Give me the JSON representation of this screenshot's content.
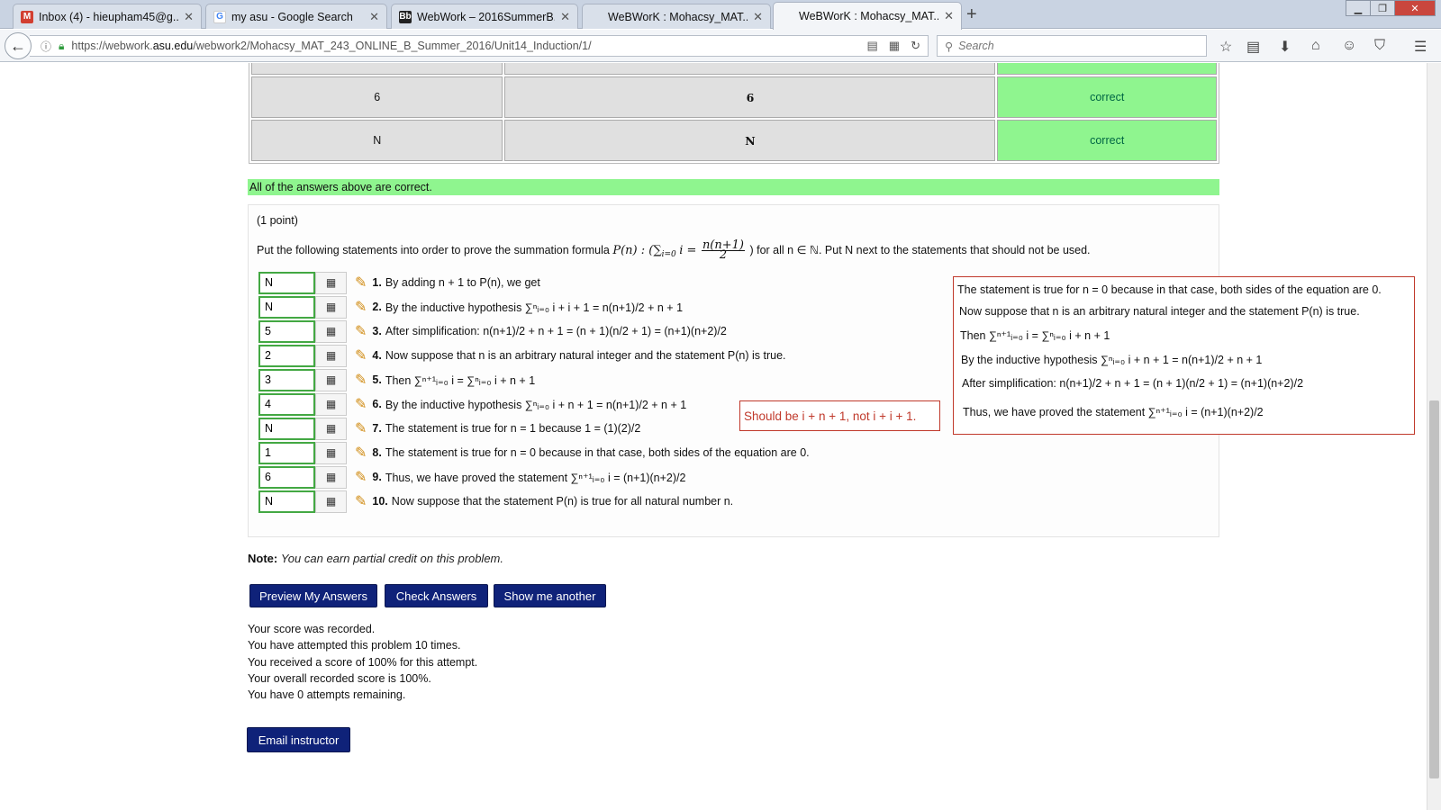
{
  "browser": {
    "tabs": [
      {
        "title": "Inbox (4) - hieupham45@g...",
        "favicon": "gmail-icon",
        "active": false
      },
      {
        "title": "my asu - Google Search",
        "favicon": "google-icon",
        "active": false
      },
      {
        "title": "WebWork – 2016SummerB...",
        "favicon": "blackboard-icon",
        "active": false
      },
      {
        "title": "WeBWorK : Mohacsy_MAT...",
        "favicon": "none",
        "active": false
      },
      {
        "title": "WeBWorK : Mohacsy_MAT...",
        "favicon": "none",
        "active": true
      }
    ],
    "url_prefix": "https://webwork.",
    "url_domain": "asu.edu",
    "url_path": "/webwork2/Mohacsy_MAT_243_ONLINE_B_Summer_2016/Unit14_Induction/1/",
    "search_placeholder": "Search"
  },
  "answers_table": {
    "rows": [
      {
        "entered": "6",
        "preview": "6",
        "result": "correct"
      },
      {
        "entered": "N",
        "preview": "N",
        "result": "correct"
      }
    ]
  },
  "all_correct_message": "All of the answers above are correct.",
  "problem": {
    "points": "(1 point)",
    "instructions_prefix": "Put the following statements into order to prove the summation formula",
    "instructions_formula_pre": "P(n) : (∑",
    "instructions_formula_i": "i =",
    "instructions_frac_top": "n(n+1)",
    "instructions_frac_bot": "2",
    "instructions_suffix": ") for all n ∈ ℕ. Put N next to the statements that should not be used.",
    "statements": [
      {
        "answer": "N",
        "num": "1.",
        "text": "By adding n + 1 to P(n), we get"
      },
      {
        "answer": "N",
        "num": "2.",
        "text": "By the inductive hypothesis ∑ⁿᵢ₌₀ i + i + 1 = n(n+1)/2 + n + 1"
      },
      {
        "answer": "5",
        "num": "3.",
        "text": "After simplification: n(n+1)/2 + n + 1 = (n + 1)(n/2 + 1) = (n+1)(n+2)/2"
      },
      {
        "answer": "2",
        "num": "4.",
        "text": "Now suppose that n is an arbitrary natural integer and the statement P(n) is true."
      },
      {
        "answer": "3",
        "num": "5.",
        "text": "Then ∑ⁿ⁺¹ᵢ₌₀ i = ∑ⁿᵢ₌₀ i + n + 1"
      },
      {
        "answer": "4",
        "num": "6.",
        "text": "By the inductive hypothesis ∑ⁿᵢ₌₀ i + n + 1 = n(n+1)/2 + n + 1"
      },
      {
        "answer": "N",
        "num": "7.",
        "text": "The statement is true for n = 1 because 1 = (1)(2)/2"
      },
      {
        "answer": "1",
        "num": "8.",
        "text": "The statement is true for n = 0 because in that case, both sides of the equation are 0."
      },
      {
        "answer": "6",
        "num": "9.",
        "text": "Thus, we have proved the statement ∑ⁿ⁺¹ᵢ₌₀ i = (n+1)(n+2)/2"
      },
      {
        "answer": "N",
        "num": "10.",
        "text": "Now suppose that the statement P(n) is true for all natural number n."
      }
    ],
    "hint": "Should be i + n + 1, not i + i + 1.",
    "preview_lines": [
      "The statement is true for n = 0 because in that case, both sides of the equation are 0.",
      "Now suppose that n is an arbitrary natural integer and the statement P(n) is true.",
      "Then ∑ⁿ⁺¹ᵢ₌₀ i = ∑ⁿᵢ₌₀ i + n + 1",
      "By the inductive hypothesis ∑ⁿᵢ₌₀ i + n + 1 = n(n+1)/2 + n + 1",
      "After simplification: n(n+1)/2 + n + 1 = (n + 1)(n/2 + 1) = (n+1)(n+2)/2",
      "Thus, we have proved the statement ∑ⁿ⁺¹ᵢ₌₀ i = (n+1)(n+2)/2"
    ]
  },
  "note_label": "Note:",
  "note_text": "You can earn partial credit on this problem.",
  "buttons": {
    "preview": "Preview My Answers",
    "check": "Check Answers",
    "another": "Show me another",
    "email": "Email instructor"
  },
  "status_lines": [
    "Your score was recorded.",
    "You have attempted this problem 10 times.",
    "You received a score of 100% for this attempt.",
    "Your overall recorded score is 100%.",
    "You have 0 attempts remaining."
  ],
  "colors": {
    "correct_bg": "#8ff58f",
    "button_bg": "#0f2279",
    "hint_border": "#c0392b",
    "input_border": "#43a843"
  }
}
